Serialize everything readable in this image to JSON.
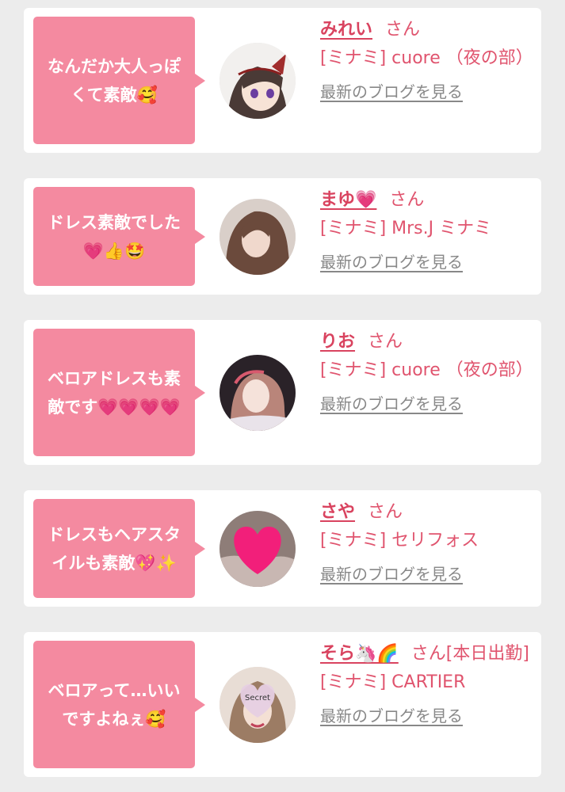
{
  "colors": {
    "bubble": "#f48aa0",
    "name": "#d9435f",
    "shop": "#e0546e",
    "link": "#888888",
    "background": "#ececec"
  },
  "cards": [
    {
      "comment": "なんだか大人っぽ\nくて素敵🥰",
      "name": "みれい",
      "honorific": "さん",
      "shop": "[ミナミ] cuore （夜の部）",
      "blog_link": "最新のブログを見る",
      "avatar_icon": "anime-girl-avatar"
    },
    {
      "comment": "ドレス素敵でした\n💗👍🤩",
      "name": "まゆ💗",
      "honorific": "さん",
      "shop": "[ミナミ] Mrs.J ミナミ",
      "blog_link": "最新のブログを見る",
      "avatar_icon": "woman-photo-avatar"
    },
    {
      "comment": "ベロアドレスも素\n敵です💗💗💗💗",
      "name": "りお",
      "honorific": "さん",
      "shop": "[ミナミ] cuore （夜の部）",
      "blog_link": "最新のブログを見る",
      "avatar_icon": "woman-photo-avatar"
    },
    {
      "comment": "ドレスもヘアスタ\nイルも素敵💖✨",
      "name": "さや",
      "honorific": "さん",
      "shop": "[ミナミ] セリフォス",
      "blog_link": "最新のブログを見る",
      "avatar_icon": "heart-covered-photo-avatar"
    },
    {
      "comment": "ベロアって…いい\nですよねぇ🥰",
      "name": "そら🦄🌈",
      "honorific": "さん[本日出勤]",
      "shop": "[ミナミ] CARTIER",
      "blog_link": "最新のブログを見る",
      "avatar_icon": "secret-heart-photo-avatar",
      "avatar_text": "Secret"
    }
  ]
}
